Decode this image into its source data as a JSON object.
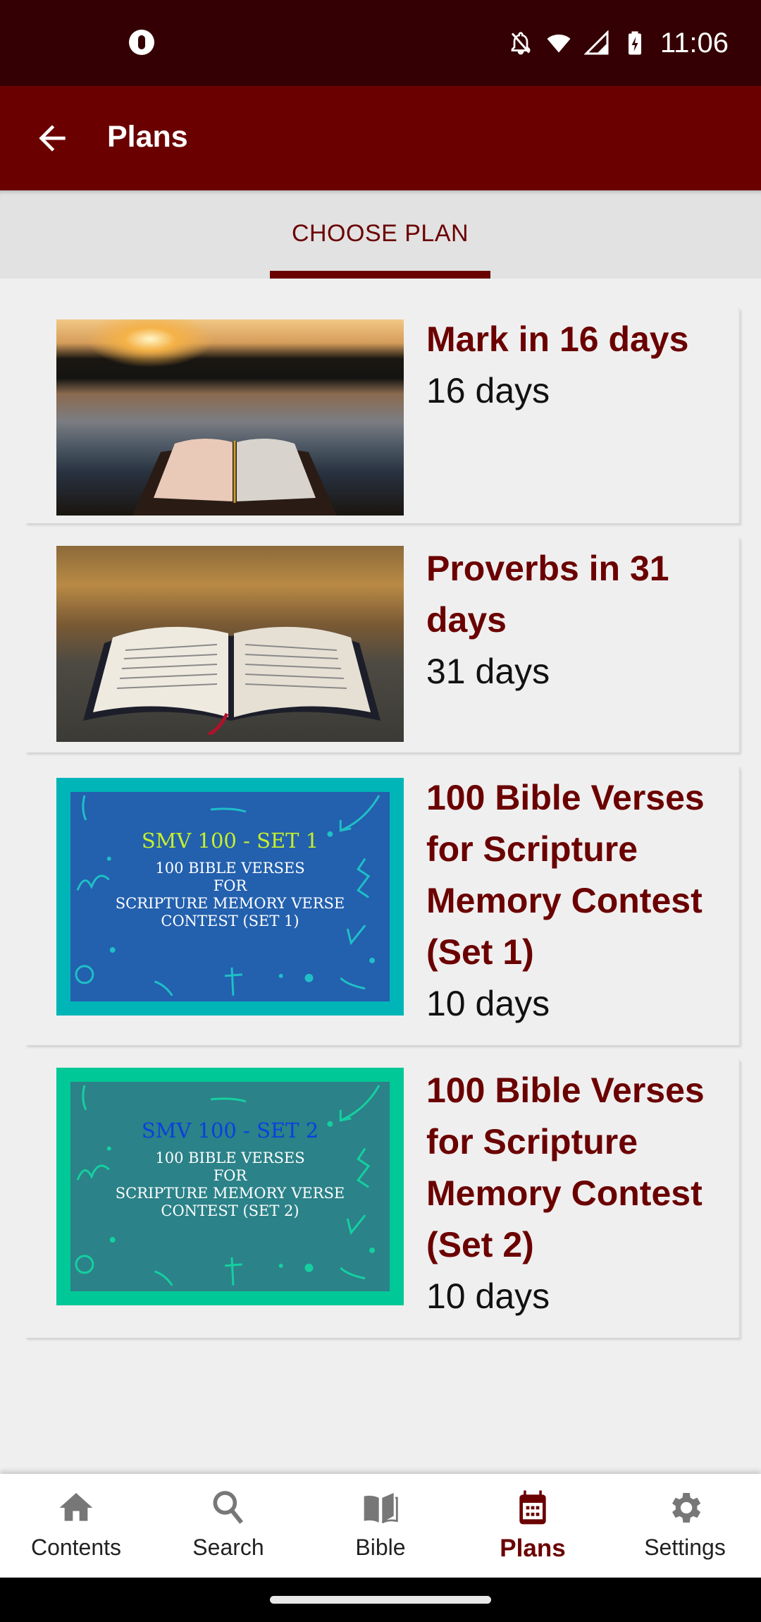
{
  "status_bar": {
    "time": "11:06",
    "icons": [
      "app-notification-icon",
      "notifications-off-icon",
      "wifi-icon",
      "cell-signal-icon",
      "battery-charging-icon"
    ]
  },
  "app_bar": {
    "title": "Plans",
    "back_icon": "arrow-back-icon"
  },
  "tabs": [
    {
      "label": "CHOOSE PLAN",
      "selected": true
    }
  ],
  "plans": [
    {
      "title": "Mark in 16 days",
      "duration": "16 days",
      "image": "sunset-lake-open-bible-photo"
    },
    {
      "title": "Proverbs in 31 days",
      "duration": "31 days",
      "image": "open-bible-on-rock-photo"
    },
    {
      "title": "100 Bible Verses for Scripture Memory Contest (Set 1)",
      "duration": "10 days",
      "image": "smv-set-1-graphic",
      "image_text": {
        "heading": "SMV 100 - SET 1",
        "lines": [
          "100 BIBLE VERSES",
          "FOR",
          "SCRIPTURE MEMORY VERSE",
          "CONTEST (SET 1)"
        ]
      },
      "image_colors": {
        "frame": "#00b5b8",
        "fill": "#2360ae",
        "heading": "#c6f02a"
      }
    },
    {
      "title": "100 Bible Verses for Scripture Memory Contest (Set 2)",
      "duration": "10 days",
      "image": "smv-set-2-graphic",
      "image_text": {
        "heading": "SMV 100 - SET 2",
        "lines": [
          "100 BIBLE VERSES",
          "FOR",
          "SCRIPTURE MEMORY VERSE",
          "CONTEST (SET 2)"
        ]
      },
      "image_colors": {
        "frame": "#00c896",
        "fill": "#2b8288",
        "heading": "#0a3fe0"
      }
    }
  ],
  "bottom_nav": [
    {
      "label": "Contents",
      "icon": "home-icon",
      "active": false
    },
    {
      "label": "Search",
      "icon": "search-icon",
      "active": false
    },
    {
      "label": "Bible",
      "icon": "book-open-icon",
      "active": false
    },
    {
      "label": "Plans",
      "icon": "calendar-icon",
      "active": true
    },
    {
      "label": "Settings",
      "icon": "gear-icon",
      "active": false
    }
  ],
  "colors": {
    "primary": "#6b0000",
    "status_bar": "#350003",
    "background": "#efefef",
    "tab_strip": "#e2e2e2",
    "inactive_icon": "#777777"
  }
}
